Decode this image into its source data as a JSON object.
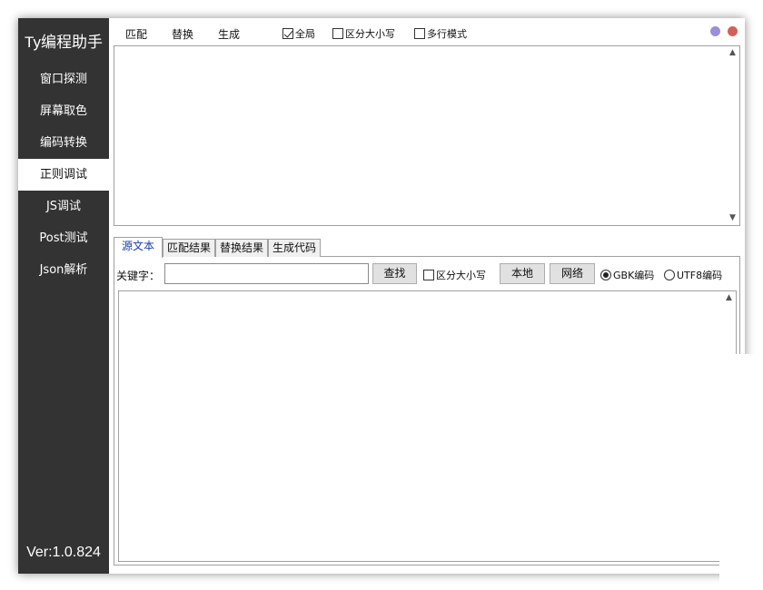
{
  "app": {
    "title": "Ty编程助手",
    "version": "Ver:1.0.824"
  },
  "sidebar": {
    "items": [
      {
        "label": "窗口探测",
        "active": false
      },
      {
        "label": "屏幕取色",
        "active": false
      },
      {
        "label": "编码转换",
        "active": false
      },
      {
        "label": "正则调试",
        "active": true
      },
      {
        "label": "JS调试",
        "active": false
      },
      {
        "label": "Post测试",
        "active": false
      },
      {
        "label": "Json解析",
        "active": false
      }
    ]
  },
  "toolbar": {
    "match_label": "匹配",
    "replace_label": "替换",
    "generate_label": "生成",
    "global_label": "全局",
    "global_checked": true,
    "case_label": "区分大小写",
    "case_checked": false,
    "multiline_label": "多行模式",
    "multiline_checked": false
  },
  "window_controls": {
    "minimize_color": "#9b8fd8",
    "close_color": "#d4605a"
  },
  "editor_top": {
    "scroll_up_icon": "chevron-up-icon",
    "scroll_down_icon": "chevron-down-icon"
  },
  "tabs": [
    {
      "label": "源文本",
      "active": true
    },
    {
      "label": "匹配结果",
      "active": false
    },
    {
      "label": "替换结果",
      "active": false
    },
    {
      "label": "生成代码",
      "active": false
    }
  ],
  "search": {
    "keyword_label": "关键字：",
    "keyword_value": "",
    "find_label": "查找",
    "case_label": "区分大小写",
    "case_checked": false,
    "local_label": "本地",
    "network_label": "网络",
    "gbk_label": "GBK编码",
    "gbk_selected": true,
    "utf8_label": "UTF8编码",
    "utf8_selected": false
  },
  "editor_bottom": {
    "scroll_up_icon": "chevron-up-icon"
  }
}
